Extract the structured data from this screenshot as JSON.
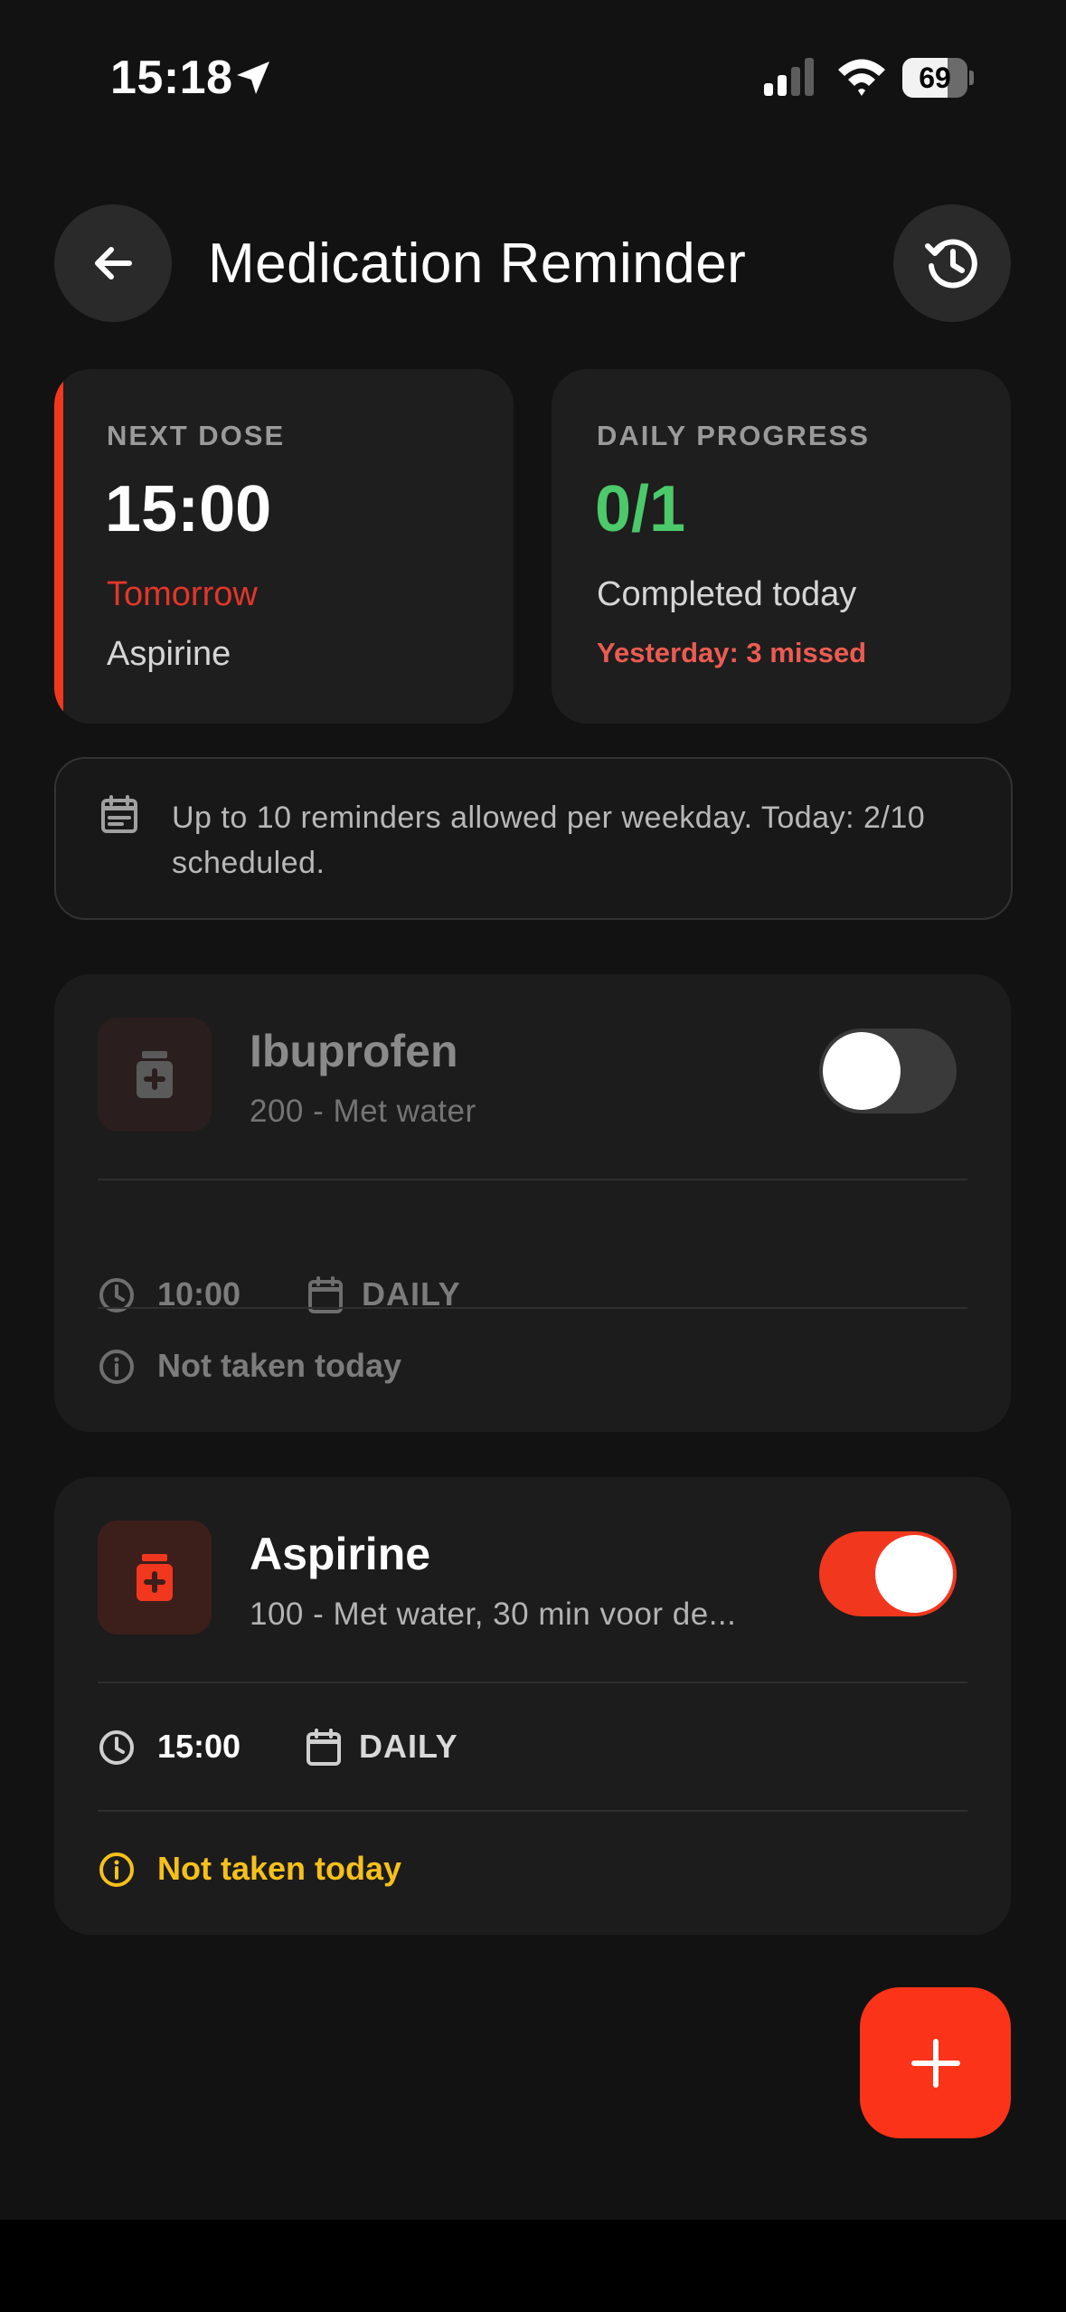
{
  "status_bar": {
    "time": "15:18",
    "battery": "69",
    "battery_level": 0.69
  },
  "header": {
    "title": "Medication Reminder",
    "back_icon": "arrow-left-icon",
    "history_icon": "history-clock-icon"
  },
  "next_dose": {
    "label": "NEXT DOSE",
    "time": "15:00",
    "when": "Tomorrow",
    "medication": "Aspirine"
  },
  "daily_progress": {
    "label": "DAILY PROGRESS",
    "value": "0/1",
    "subtitle": "Completed today",
    "missed": "Yesterday: 3 missed"
  },
  "info": {
    "text": "Up to 10 reminders allowed per weekday. Today: 2/10 scheduled.",
    "icon": "calendar-note-icon"
  },
  "medications": [
    {
      "name": "Ibuprofen",
      "description": "200 - Met water",
      "time": "10:00",
      "frequency": "DAILY",
      "status": "Not taken today",
      "enabled": false
    },
    {
      "name": "Aspirine",
      "description": "100 - Met water, 30 min voor de...",
      "time": "15:00",
      "frequency": "DAILY",
      "status": "Not taken today",
      "enabled": true
    }
  ],
  "fab": {
    "icon": "plus-icon"
  },
  "colors": {
    "accent": "#fa3319",
    "success": "#4cc96a",
    "danger": "#e44a3c",
    "warning": "#f5c01b",
    "background": "#121212",
    "card": "#1e1e1e"
  }
}
